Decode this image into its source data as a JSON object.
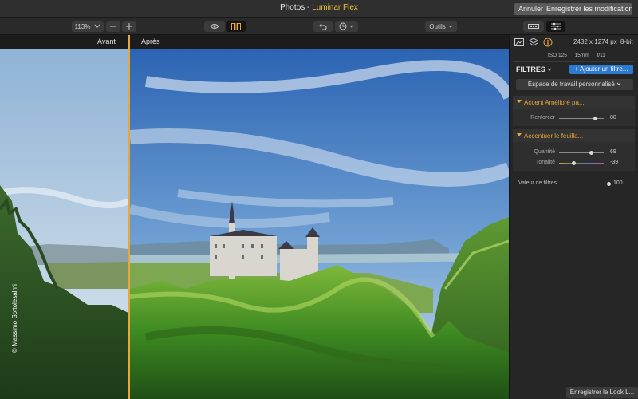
{
  "window": {
    "title_prefix": "Photos - ",
    "app_name": "Luminar Flex",
    "cancel_label": "Annuler",
    "save_label": "Enregistrer les modifications"
  },
  "toolbar": {
    "zoom_value": "113%",
    "zoom_out_icon": "minus-icon",
    "zoom_in_icon": "plus-icon",
    "tools_label": "Outils"
  },
  "canvas": {
    "before_label": "Avant",
    "after_label": "Après",
    "copyright": "© Massimo Sottolesalmi"
  },
  "panel": {
    "image_size": "2432 x 1274 px",
    "bit_depth": "8-bit",
    "meta": [
      "ISO 125",
      "15mm",
      "f/11"
    ],
    "filters_title": "FILTRES",
    "add_filter": "+ Ajouter un filtre...",
    "workspace": "Espace de travail personnalisé",
    "filters": [
      {
        "name": "Accent Amélioré pa...",
        "sliders": [
          {
            "label": "Renforcer",
            "value": "80",
            "level": 0.82
          }
        ]
      },
      {
        "name": "Accentuer le feuilla...",
        "sliders": [
          {
            "label": "Quantité",
            "value": "69",
            "level": 0.73
          },
          {
            "label": "Tonalité",
            "value": "-39",
            "level": 0.33
          }
        ]
      }
    ],
    "global_opacity": {
      "label": "Valeur de filtres",
      "value": "100",
      "level": 1.0
    },
    "save_look": "Enregistrer le Look L..."
  },
  "colors": {
    "accent": "#e8a73a",
    "primary_button": "#2d7ad1",
    "background": "#1e1e1e"
  }
}
